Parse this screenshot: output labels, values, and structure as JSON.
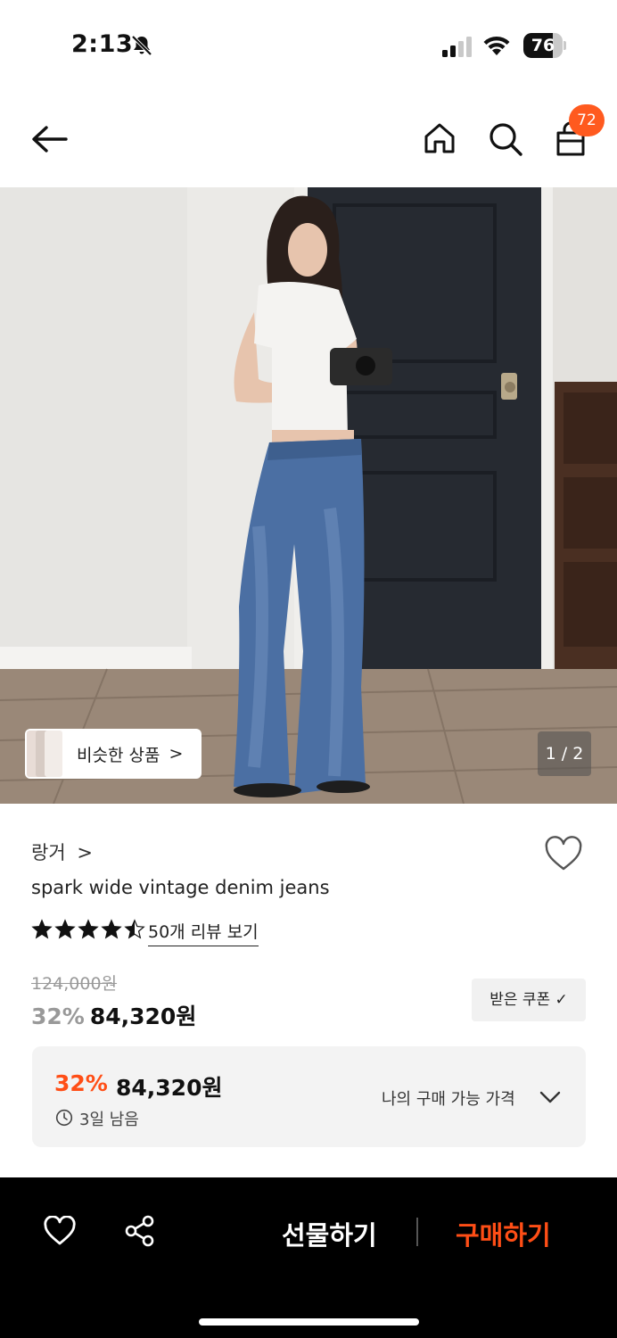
{
  "status_bar": {
    "time": "2:13",
    "battery_level": 76,
    "battery_text": "76",
    "icons": [
      "bell-muted-icon",
      "cellular-signal-icon",
      "wifi-icon",
      "battery-icon"
    ]
  },
  "header": {
    "icons": [
      "back-arrow-icon",
      "home-icon",
      "search-icon",
      "shopping-bag-icon"
    ],
    "cart_count": "72",
    "badge_color": "#ff5a1f"
  },
  "gallery": {
    "similar_label": "비슷한 상품",
    "similar_chevron": ">",
    "page_indicator": "1 / 2"
  },
  "product": {
    "brand": "랑거",
    "brand_chevron": ">",
    "name": "spark wide vintage denim jeans",
    "rating": 4.5,
    "review_link": "50개 리뷰 보기",
    "original_price": "124,000원",
    "discount": "32%",
    "price": "84,320원",
    "coupon_label": "받은 쿠폰 ✓"
  },
  "my_price_card": {
    "discount": "32%",
    "price": "84,320원",
    "remaining": "3일 남음",
    "label": "나의 구매 가능 가격",
    "accent_color": "#ff4e16"
  },
  "bottom_bar": {
    "icons": [
      "heart-icon",
      "share-icon"
    ],
    "gift_label": "선물하기",
    "buy_label": "구매하기",
    "buy_color": "#ff4e16"
  }
}
